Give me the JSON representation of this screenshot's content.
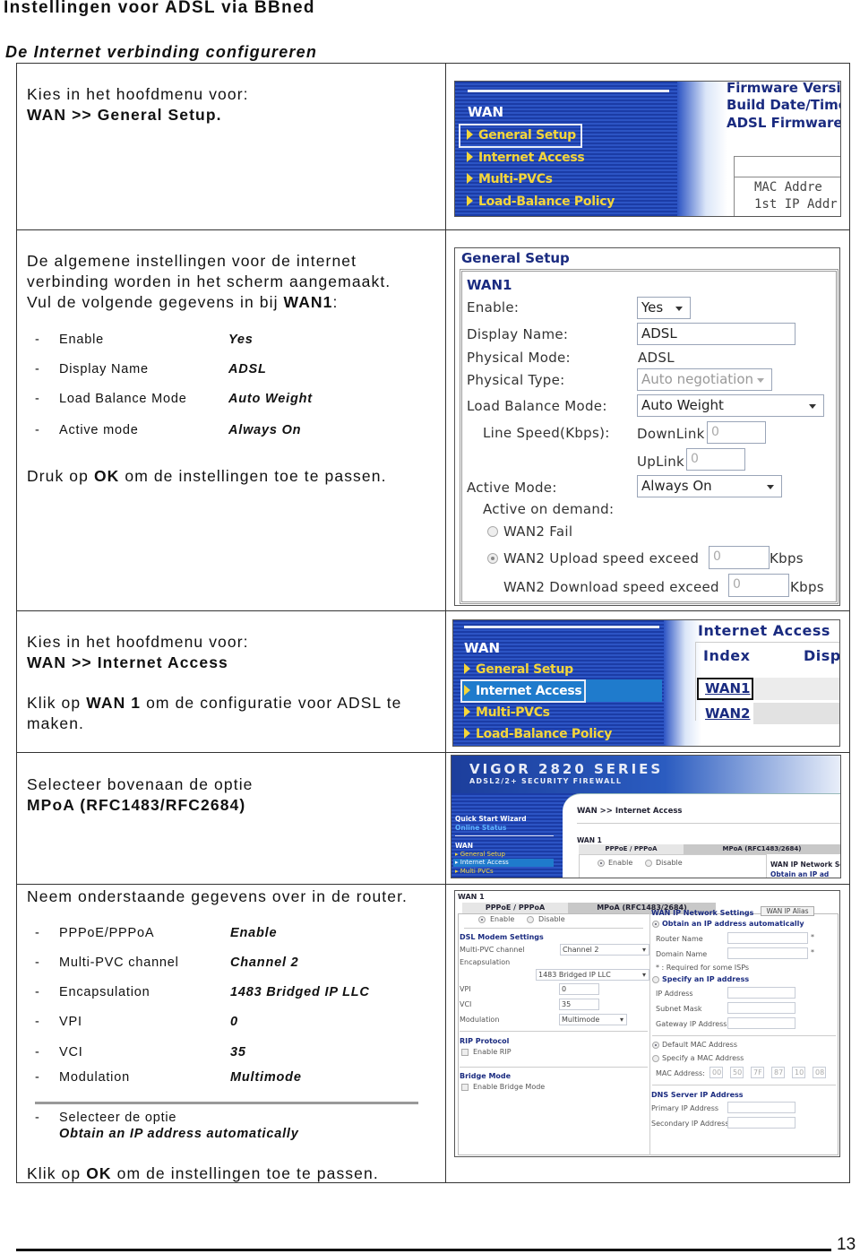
{
  "doc": {
    "title": "Instellingen voor ADSL via BBned",
    "subtitle": "De Internet verbinding configureren",
    "page_number": "13"
  },
  "step1": {
    "line1": "Kies in het hoofdmenu voor:",
    "line2": "WAN >> General Setup."
  },
  "step2": {
    "intro1": "De algemene instellingen voor de internet",
    "intro2": "verbinding worden in het scherm aangemaakt.",
    "intro3_pre": "Vul de volgende gegevens in bij ",
    "intro3_bold": "WAN1",
    "intro3_post": ":",
    "settings": [
      {
        "key": "Enable",
        "value": "Yes"
      },
      {
        "key": "Display Name",
        "value": "ADSL"
      },
      {
        "key": "Load Balance Mode",
        "value": "Auto Weight"
      },
      {
        "key": "Active mode",
        "value": "Always On"
      }
    ],
    "outro_pre": "Druk op ",
    "outro_bold": "OK",
    "outro_post": " om de instellingen toe te passen."
  },
  "step3": {
    "line1": "Kies in het hoofdmenu voor:",
    "line2": "WAN >> Internet Access",
    "line3_pre": "Klik op ",
    "line3_bold": "WAN 1",
    "line3_post": " om de configuratie voor ADSL te",
    "line4": "maken."
  },
  "step4": {
    "line1": "Selecteer bovenaan de optie",
    "line2": "MPoA (RFC1483/RFC2684)"
  },
  "step5": {
    "intro": "Neem onderstaande gegevens over in de router.",
    "settings": [
      {
        "key": "PPPoE/PPPoA",
        "value": "Enable"
      },
      {
        "key": "Multi-PVC channel",
        "value": "Channel 2"
      },
      {
        "key": "Encapsulation",
        "value": "1483 Bridged IP LLC"
      },
      {
        "key": "VPI",
        "value": "0"
      },
      {
        "key": "VCI",
        "value": "35"
      },
      {
        "key": "Modulation",
        "value": "Multimode"
      }
    ],
    "option_line1": "Selecteer de optie",
    "option_line2": "Obtain an IP address automatically",
    "outro_pre": "Klik op ",
    "outro_bold": "OK",
    "outro_post": " om de instellingen toe te passen."
  },
  "menu_shot": {
    "section": "WAN",
    "items": [
      "General Setup",
      "Internet Access",
      "Multi-PVCs",
      "Load-Balance Policy"
    ],
    "right_lines": [
      "Firmware Versi",
      "Build Date/Time",
      "ADSL Firmware"
    ],
    "table_lines": [
      "MAC Addre",
      "1st IP Addr"
    ]
  },
  "general_setup": {
    "title": "General Setup",
    "wan": "WAN1",
    "enable_label": "Enable:",
    "enable_value": "Yes",
    "display_name_label": "Display Name:",
    "display_name_value": "ADSL",
    "physical_mode_label": "Physical Mode:",
    "physical_mode_value": "ADSL",
    "physical_type_label": "Physical Type:",
    "physical_type_value": "Auto negotiation",
    "load_balance_label": "Load Balance Mode:",
    "load_balance_value": "Auto Weight",
    "line_speed_label": "Line Speed(Kbps):",
    "downlink_label": "DownLink",
    "downlink_value": "0",
    "uplink_label": "UpLink",
    "uplink_value": "0",
    "active_mode_label": "Active Mode:",
    "active_mode_value": "Always On",
    "active_on_demand_label": "Active on demand:",
    "wan2_fail_label": "WAN2 Fail",
    "wan2_upload_label": "WAN2 Upload speed exceed",
    "wan2_upload_value": "0",
    "wan2_download_label": "WAN2 Download speed exceed",
    "wan2_download_value": "0",
    "unit": "Kbps"
  },
  "internet_access_shot": {
    "title": "Internet Access",
    "col_index": "Index",
    "col_display": "Displ",
    "rows": [
      "WAN1",
      "WAN2"
    ]
  },
  "vigor_shot": {
    "brand": "VIGOR 2820 SERIES",
    "tagline": "ADSL2/2+ SECURITY FIREWALL",
    "quick_start": "Quick Start Wizard",
    "online_status": "Online Status",
    "section": "WAN",
    "items": [
      "General Setup",
      "Internet Access",
      "Multi PVCs"
    ],
    "breadcrumb": "WAN >> Internet Access",
    "wan_label": "WAN 1",
    "tab_pppoe": "PPPoE / PPPoA",
    "tab_mpoa": "MPoA (RFC1483/2684)",
    "enable": "Enable",
    "disable": "Disable",
    "wan_ip_settings": "WAN IP Network Se",
    "obtain": "Obtain an IP ad"
  },
  "mpoa_shot": {
    "wan_label": "WAN 1",
    "tab_pppoe": "PPPoE / PPPoA",
    "tab_mpoa": "MPoA (RFC1483/2684)",
    "enable": "Enable",
    "disable": "Disable",
    "dsl_header": "DSL Modem Settings",
    "multi_pvc_label": "Multi-PVC channel",
    "multi_pvc_value": "Channel 2",
    "encapsulation_label": "Encapsulation",
    "encapsulation_value": "1483 Bridged IP LLC",
    "vpi_label": "VPI",
    "vpi_value": "0",
    "vci_label": "VCI",
    "vci_value": "35",
    "modulation_label": "Modulation",
    "modulation_value": "Multimode",
    "rip_header": "RIP Protocol",
    "enable_rip": "Enable RIP",
    "bridge_header": "Bridge Mode",
    "enable_bridge": "Enable Bridge Mode",
    "wan_ip_header": "WAN IP Network Settings",
    "wan_ip_alias": "WAN IP Alias",
    "obtain": "Obtain an IP address automatically",
    "router_name": "Router Name",
    "domain_name": "Domain Name",
    "required_note": "* : Required for some ISPs",
    "specify_ip": "Specify an IP address",
    "ip_address": "IP Address",
    "subnet_mask": "Subnet Mask",
    "gateway_ip": "Gateway IP Address",
    "default_mac": "Default MAC Address",
    "specify_mac": "Specify a MAC Address",
    "mac_label": "MAC Address:",
    "mac_octets": [
      "00",
      "50",
      "7F",
      "87",
      "10",
      "08"
    ],
    "dns_header": "DNS Server IP Address",
    "primary_dns": "Primary IP Address",
    "secondary_dns": "Secondary IP Address"
  }
}
